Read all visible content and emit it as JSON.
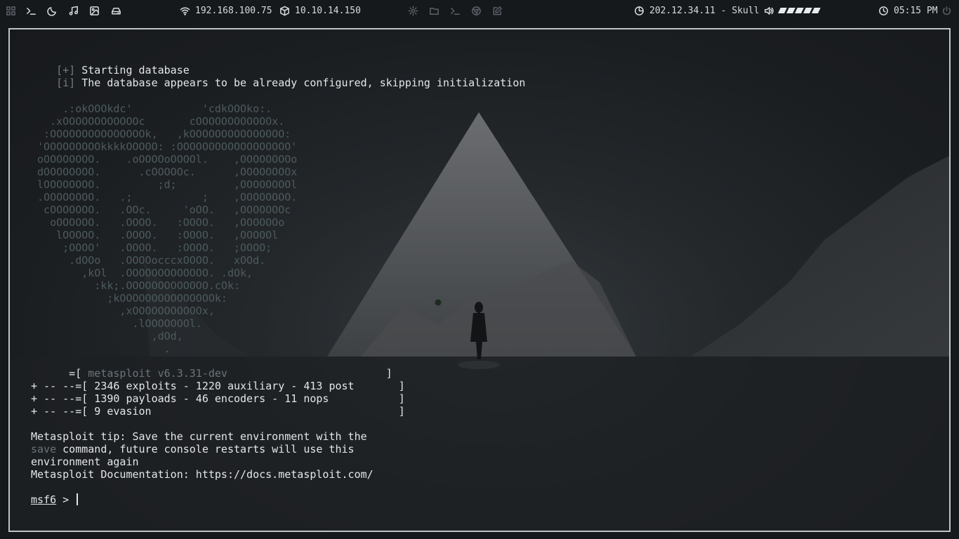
{
  "topbar": {
    "left_icons": [
      "grid-icon",
      "terminal-icon",
      "moon-icon",
      "music-icon",
      "image-icon",
      "drive-icon"
    ],
    "wifi_ip": "192.168.100.75",
    "vpn_ip": "10.10.14.150",
    "center_icons": [
      "gear-icon",
      "folder-icon",
      "terminal-icon",
      "browser-icon",
      "edit-icon"
    ],
    "target": "202.12.34.11 - Skull",
    "volume_level": 5,
    "clock": "05:15 PM",
    "accent": "#e8ebee",
    "dim": "#5b6268"
  },
  "terminal": {
    "status_lines": [
      {
        "tag": "[+]",
        "text": "Starting database"
      },
      {
        "tag": "[i]",
        "text": "The database appears to be already configured, skipping initialization"
      }
    ],
    "banner_art": [
      "     .:okOOOkdc'           'cdkOOOko:.",
      "   .xOOOOOOOOOOOOc       cOOOOOOOOOOOOx.",
      "  :OOOOOOOOOOOOOOOk,   ,kOOOOOOOOOOOOOOO:",
      " 'OOOOOOOOOkkkkOOOOO: :OOOOOOOOOOOOOOOOOO'",
      " oOOOOOOOO.    .oOOOOoOOOOl.    ,OOOOOOOOo",
      " dOOOOOOOO.      .cOOOOOc.      ,OOOOOOOOx",
      " lOOOOOOOO.         ;d;         ,OOOOOOOOl",
      " .OOOOOOOO.   .;           ;    ,OOOOOOOO.",
      "  cOOOOOOO.   .OOc.     'oOO.   ,OOOOOOOc",
      "   oOOOOOO.   .OOOO.   :OOOO.   ,OOOOOOo",
      "    lOOOOO.   .OOOO.   :OOOO.   ,OOOOOl",
      "     ;OOOO'   .OOOO.   :OOOO.   ;OOOO;",
      "      .dOOo   .OOOOocccxOOOO.   xOOd.",
      "        ,kOl  .OOOOOOOOOOOOO. .dOk,",
      "          :kk;.OOOOOOOOOOOOO.cOk:",
      "            ;kOOOOOOOOOOOOOOOk:",
      "              ,xOOOOOOOOOOOx,",
      "                .lOOOOOOOl.",
      "                   ,dOd,",
      "                     ."
    ],
    "banner": {
      "version_prefix": "      =[ ",
      "version": "metasploit v6.3.31-dev",
      "version_suffix": "                         ]",
      "stats": [
        "+ -- --=[ 2346 exploits - 1220 auxiliary - 413 post       ]",
        "+ -- --=[ 1390 payloads - 46 encoders - 11 nops           ]",
        "+ -- --=[ 9 evasion                                       ]"
      ]
    },
    "tip": {
      "line1": "Metasploit tip: Save the current environment with the",
      "keyword": "save",
      "line2_rest": " command, future console restarts will use this",
      "line3": "environment again"
    },
    "docs_line": "Metasploit Documentation: https://docs.metasploit.com/",
    "prompt": {
      "name": "msf6",
      "symbol": " > "
    }
  }
}
